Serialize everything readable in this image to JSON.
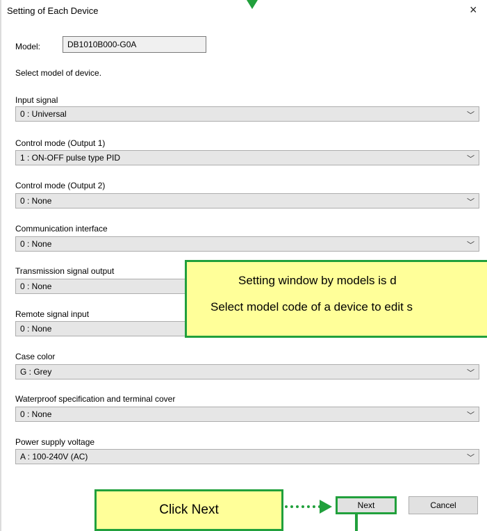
{
  "window": {
    "title": "Setting of Each Device",
    "close_glyph": "×"
  },
  "model": {
    "label": "Model:",
    "value": "DB1010B000-G0A"
  },
  "hint": "Select model of device.",
  "fields": [
    {
      "label": "Input signal",
      "value": "0 : Universal"
    },
    {
      "label": "Control mode (Output 1)",
      "value": "1 : ON-OFF pulse type PID"
    },
    {
      "label": "Control mode (Output 2)",
      "value": "0 : None"
    },
    {
      "label": "Communication interface",
      "value": "0 : None"
    },
    {
      "label": "Transmission signal output",
      "value": "0 : None"
    },
    {
      "label": "Remote signal input",
      "value": "0 : None"
    },
    {
      "label": "Case color",
      "value": "G : Grey"
    },
    {
      "label": "Waterproof specification and terminal cover",
      "value": "0 : None"
    },
    {
      "label": "Power supply voltage",
      "value": "A : 100-240V (AC)"
    }
  ],
  "buttons": {
    "next": "Next",
    "cancel": "Cancel"
  },
  "callouts": {
    "info_line1": "Setting window by models is d",
    "info_line2": "Select model code of a device to edit s",
    "click_next": "Click Next"
  },
  "colors": {
    "accent": "#21a03c",
    "callout_bg": "#ffff99"
  }
}
